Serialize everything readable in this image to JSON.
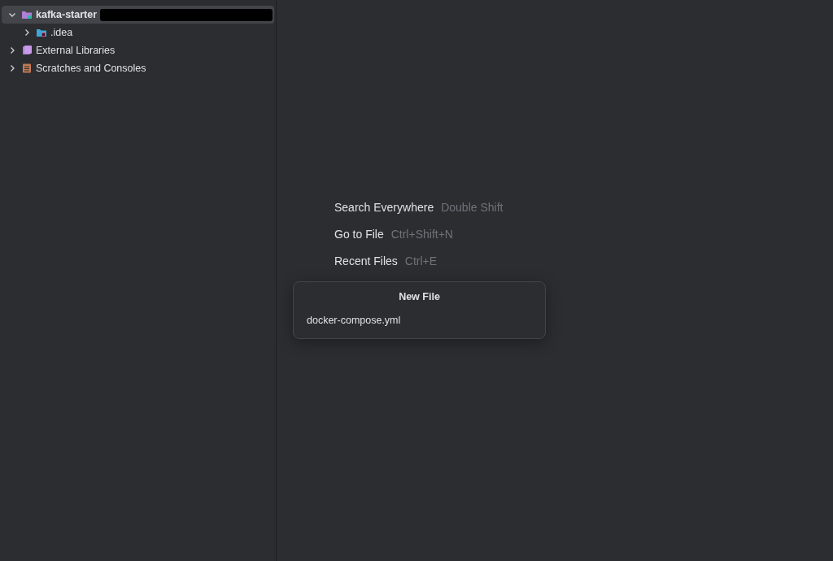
{
  "project_tree": [
    {
      "label": "kafka-starter",
      "kind": "project",
      "expanded": true,
      "selected": true,
      "redacted": true,
      "children": [
        {
          "label": ".idea",
          "kind": "folder",
          "expanded": false,
          "selected": false
        }
      ]
    },
    {
      "label": "External Libraries",
      "kind": "libraries",
      "expanded": false,
      "selected": false
    },
    {
      "label": "Scratches and Consoles",
      "kind": "scratches",
      "expanded": false,
      "selected": false
    }
  ],
  "hints": [
    {
      "action": "Search Everywhere",
      "shortcut": "Double Shift"
    },
    {
      "action": "Go to File",
      "shortcut": "Ctrl+Shift+N"
    },
    {
      "action": "Recent Files",
      "shortcut": "Ctrl+E"
    }
  ],
  "new_file_popup": {
    "title": "New File",
    "value": "docker-compose.yml"
  }
}
